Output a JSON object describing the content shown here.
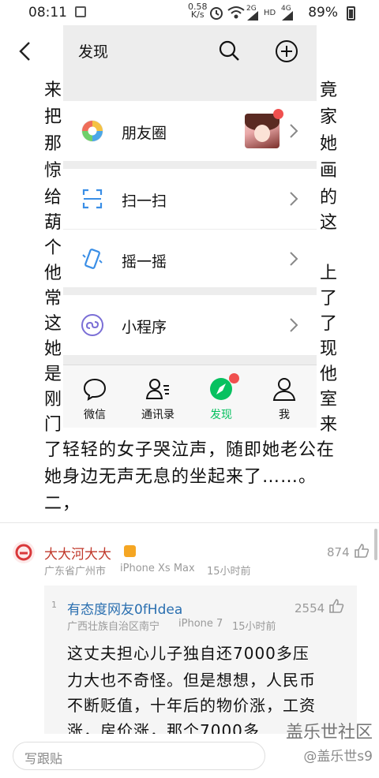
{
  "status_bar": {
    "time": "08:11",
    "net_speed_value": "0.58",
    "net_speed_unit": "K/s",
    "signal_2g": "2G",
    "hd": "HD",
    "signal_4g": "4G",
    "battery": "89%"
  },
  "article": {
    "lines": [
      "来",
      "把",
      "那",
      "惊",
      "给",
      "葫",
      "个",
      "他",
      "常",
      "这",
      "她",
      "是",
      "刚",
      "门",
      "了轻轻的女子哭泣声，随即她老公在",
      "她身边无声无息的坐起来了……。",
      "二，"
    ],
    "right_edge": [
      "竟",
      "家",
      "她",
      "画",
      "的",
      "这",
      "上",
      "了",
      "了",
      "现",
      "他",
      "室",
      "来"
    ]
  },
  "discover": {
    "title": "发现",
    "items": {
      "moments": "朋友圈",
      "scan": "扫一扫",
      "shake": "摇一摇",
      "mini_programs": "小程序"
    },
    "tabs": {
      "chats": "微信",
      "contacts": "通讯录",
      "discover": "发现",
      "me": "我"
    },
    "accent": "#07c160",
    "badge_color": "#f0504f"
  },
  "comments": {
    "top": {
      "name": "大大河大大",
      "location": "广东省广州市",
      "device": "iPhone Xs Max",
      "time": "15小时前",
      "likes": "874"
    },
    "reply": {
      "index": "1",
      "name": "有态度网友0fHdea",
      "location": "广西壮族自治区南宁",
      "device": "iPhone 7",
      "time": "15小时前",
      "likes": "2554",
      "text_lines": [
        "这丈夫担心儿子独自还7000多压",
        "力大也不奇怪。但是想想，人民币",
        "不断贬值，十年后的物价涨，工资",
        "涨，房价涨，那个7000多"
      ]
    }
  },
  "composer": {
    "placeholder": "写跟贴"
  },
  "watermark": {
    "line1": "盖乐世社区",
    "line2": "@盖乐世s9"
  }
}
